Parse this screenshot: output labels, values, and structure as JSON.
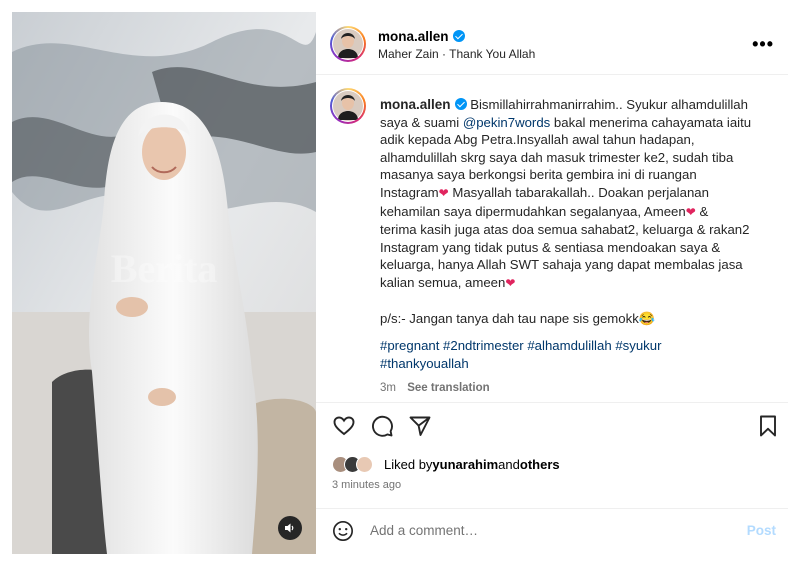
{
  "post": {
    "username": "mona.allen",
    "audio_artist": "Maher Zain",
    "audio_separator": "·",
    "audio_track": "Thank You Allah",
    "more_icon": "ellipsis-icon",
    "caption": {
      "line1": "Bismillahirrahmanirrahim.. Syukur alhamdulillah",
      "line2_a": "saya & suami ",
      "mention": "@pekin7words",
      "line2_b": " bakal menerima cahayamata iaitu",
      "line3": "adik kepada Abg Petra.Insyallah awal tahun hadapan,",
      "line4": "alhamdulillah skrg saya dah masuk trimester ke2, sudah tiba",
      "line5": "masanya saya berkongsi berita gembira ini di ruangan",
      "line6_a": "Instagram",
      "line6_b": " Masyallah tabarakallah.. Doakan perjalanan",
      "line7_a": "kehamilan saya dipermudahkan segalanyaa, Ameen",
      "line7_b": " &",
      "line8": "terima kasih juga atas doa semua sahabat2, keluarga & rakan2",
      "line9": "Instagram yang tidak putus & sentiasa mendoakan saya &",
      "line10": "keluarga, hanya Allah SWT sahaja yang dapat membalas jasa",
      "line11_a": "kalian semua, ameen",
      "ps": "p/s:- Jangan tanya dah tau nape sis gemokk😂",
      "hashtags_line1": "#pregnant #2ndtrimester #alhamdulillah #syukur",
      "hashtags_line2": "#thankyouallah"
    },
    "heart_glyph": "❤",
    "age": "3m",
    "see_translation": "See translation",
    "liked_by_prefix": "Liked by ",
    "liked_by_user": "yunarahim",
    "liked_by_and": " and ",
    "liked_by_others": "others",
    "timestamp": "3 minutes ago",
    "comment_placeholder": "Add a comment…",
    "post_button": "Post"
  },
  "colors": {
    "link": "#00376b",
    "verified": "#0095f6",
    "heart": "#e0245e",
    "post_disabled": "#b3dbff",
    "muted": "#737373"
  }
}
